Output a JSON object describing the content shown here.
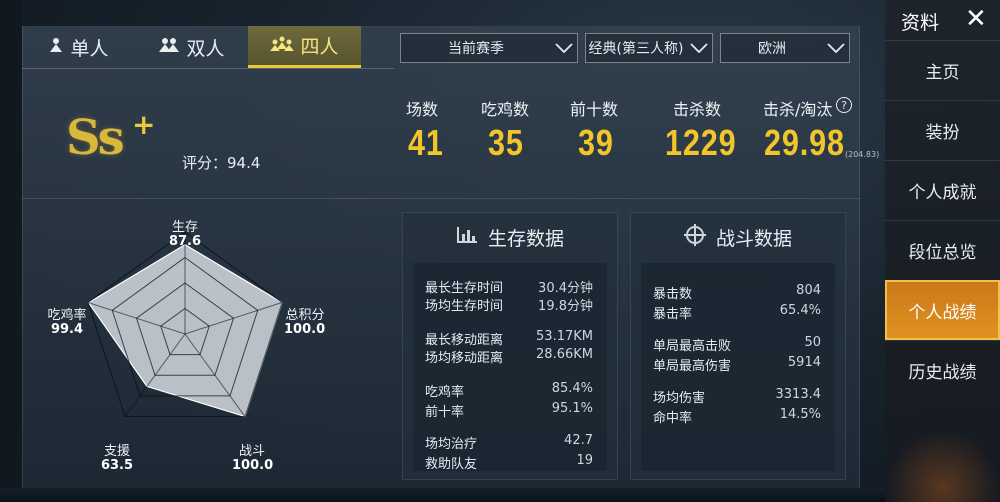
{
  "modes": [
    {
      "label": "单人",
      "icon": "person-icon",
      "active": false
    },
    {
      "label": "双人",
      "icon": "duo-icon",
      "active": false
    },
    {
      "label": "四人",
      "icon": "squad-icon",
      "active": true
    }
  ],
  "filters": {
    "season": "当前赛季",
    "mode": "经典(第三人称)",
    "region": "欧洲"
  },
  "rank": {
    "logo_text": "Ss",
    "plus": "+",
    "rating_label": "评分：",
    "rating_value": "94.4"
  },
  "stats": [
    {
      "label": "场数",
      "value": "41"
    },
    {
      "label": "吃鸡数",
      "value": "35"
    },
    {
      "label": "前十数",
      "value": "39"
    },
    {
      "label": "击杀数",
      "value": "1229"
    },
    {
      "label": "击杀/淘汰",
      "value": "29.98",
      "sub": "(204.83)",
      "help": "?"
    }
  ],
  "radar": {
    "axes": [
      {
        "label": "生存",
        "value": "87.6",
        "level": 0.876
      },
      {
        "label": "总积分",
        "value": "100.0",
        "level": 1.0
      },
      {
        "label": "战斗",
        "value": "100.0",
        "level": 1.0
      },
      {
        "label": "支援",
        "value": "63.5",
        "level": 0.635
      },
      {
        "label": "吃鸡率",
        "value": "99.4",
        "level": 0.994
      }
    ]
  },
  "survival": {
    "title": "生存数据",
    "icon": "bar-chart-icon",
    "rows": [
      {
        "k": "最长生存时间",
        "v": "30.4分钟"
      },
      {
        "k": "场均生存时间",
        "v": "19.8分钟"
      },
      {
        "k": "最长移动距离",
        "v": "53.17KM"
      },
      {
        "k": "场均移动距离",
        "v": "28.66KM"
      },
      {
        "k": "吃鸡率",
        "v": "85.4%"
      },
      {
        "k": "前十率",
        "v": "95.1%"
      },
      {
        "k": "场均治疗",
        "v": "42.7"
      },
      {
        "k": "救助队友",
        "v": "19"
      }
    ]
  },
  "combat": {
    "title": "战斗数据",
    "icon": "crosshair-icon",
    "rows": [
      {
        "k": "暴击数",
        "v": "804"
      },
      {
        "k": "暴击率",
        "v": "65.4%"
      },
      {
        "k": "单局最高击败",
        "v": "50"
      },
      {
        "k": "单局最高伤害",
        "v": "5914"
      },
      {
        "k": "场均伤害",
        "v": "3313.4"
      },
      {
        "k": "命中率",
        "v": "14.5%"
      }
    ]
  },
  "sidebar": {
    "title": "资料",
    "close": "✕",
    "items": [
      {
        "label": "主页",
        "active": false
      },
      {
        "label": "装扮",
        "active": false
      },
      {
        "label": "个人成就",
        "active": false
      },
      {
        "label": "段位总览",
        "active": false
      },
      {
        "label": "个人战绩",
        "active": true
      },
      {
        "label": "历史战绩",
        "active": false
      }
    ]
  }
}
